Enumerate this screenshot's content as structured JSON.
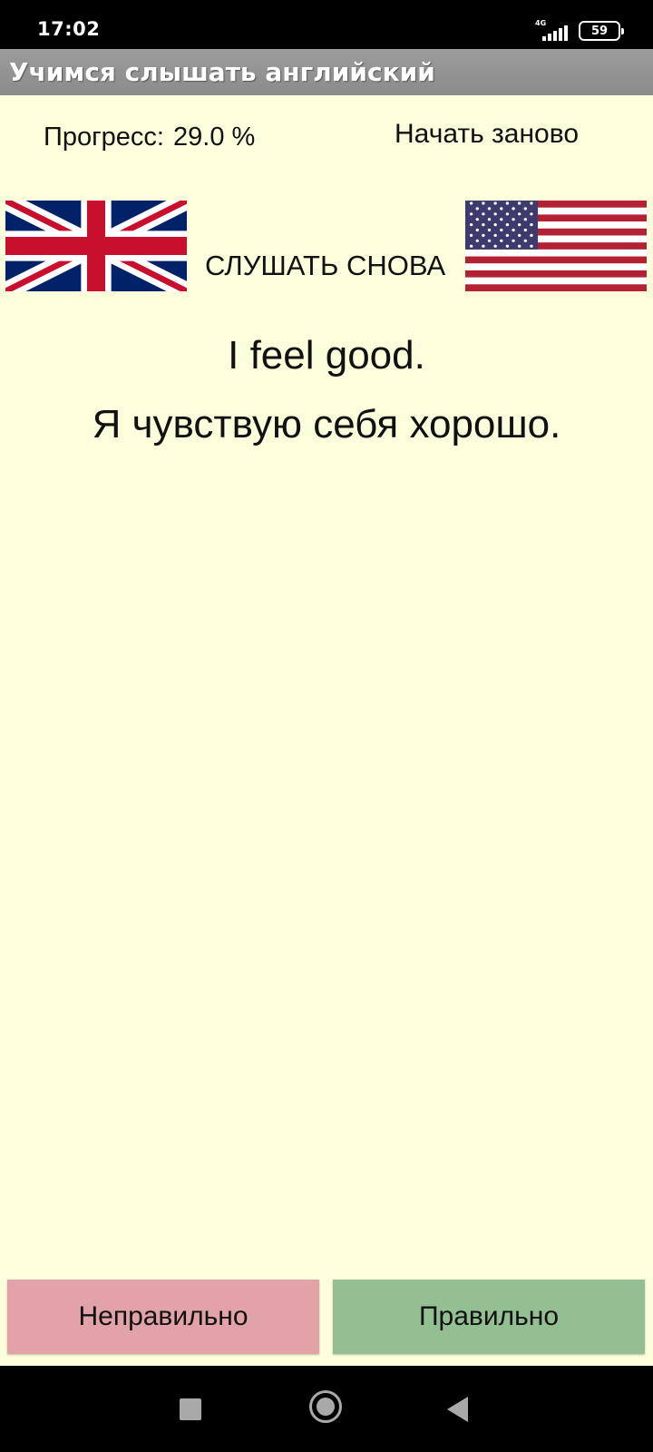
{
  "status_bar": {
    "time": "17:02",
    "network": "4G",
    "battery": "59"
  },
  "app_bar": {
    "title": "Учимся слышать английский"
  },
  "header": {
    "progress_label": "Прогресс:",
    "progress_value": "29.0 %",
    "restart_label": "Начать заново"
  },
  "player": {
    "uk_flag": "uk-flag-icon",
    "us_flag": "us-flag-icon",
    "listen_again_label": "СЛУШАТЬ СНОВА"
  },
  "phrase": {
    "english": "I feel good.",
    "russian": "Я чувствую себя хорошо."
  },
  "answer_buttons": {
    "wrong_label": "Неправильно",
    "right_label": "Правильно"
  },
  "colors": {
    "background": "#fcfedc",
    "app_bar": "#8f8f8f",
    "wrong_button": "#e1a2a8",
    "right_button": "#94bf92"
  },
  "nav_bar": {
    "icons": [
      "recents-square-icon",
      "home-circle-icon",
      "back-triangle-icon"
    ]
  }
}
